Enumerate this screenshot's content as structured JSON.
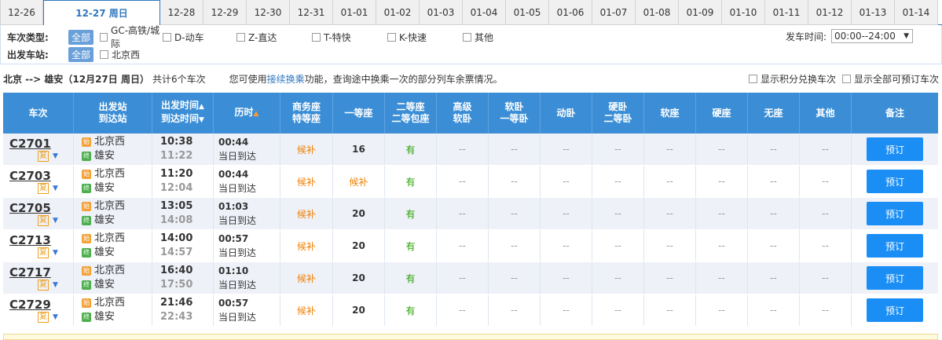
{
  "date_tabs": [
    {
      "label": "12-26",
      "active": false
    },
    {
      "label": "12-27 周日",
      "active": true
    },
    {
      "label": "12-28",
      "active": false
    },
    {
      "label": "12-29",
      "active": false
    },
    {
      "label": "12-30",
      "active": false
    },
    {
      "label": "12-31",
      "active": false
    },
    {
      "label": "01-01",
      "active": false
    },
    {
      "label": "01-02",
      "active": false
    },
    {
      "label": "01-03",
      "active": false
    },
    {
      "label": "01-04",
      "active": false
    },
    {
      "label": "01-05",
      "active": false
    },
    {
      "label": "01-06",
      "active": false
    },
    {
      "label": "01-07",
      "active": false
    },
    {
      "label": "01-08",
      "active": false
    },
    {
      "label": "01-09",
      "active": false
    },
    {
      "label": "01-10",
      "active": false
    },
    {
      "label": "01-11",
      "active": false
    },
    {
      "label": "01-12",
      "active": false
    },
    {
      "label": "01-13",
      "active": false
    },
    {
      "label": "01-14",
      "active": false
    }
  ],
  "filters": {
    "train_type_label": "车次类型:",
    "all_label": "全部",
    "train_types": [
      "GC-高铁/城际",
      "D-动车",
      "Z-直达",
      "T-特快",
      "K-快速",
      "其他"
    ],
    "station_label": "出发车站:",
    "stations": [
      "北京西"
    ],
    "depart_time_label": "发车时间:",
    "depart_time_value": "00:00--24:00"
  },
  "summary": {
    "route": "北京 --> 雄安（12月27日  周日）",
    "count": "共计6个车次",
    "tip_pre": "您可使用",
    "tip_link": "接续换乘",
    "tip_post": "功能，查询途中换乘一次的部分列车余票情况。",
    "opt1": "显示积分兑换车次",
    "opt2": "显示全部可预订车次"
  },
  "headers": {
    "train": "车次",
    "station1": "出发站",
    "station2": "到达站",
    "time1": "出发时间",
    "time2": "到达时间",
    "duration": "历时",
    "business1": "商务座",
    "business2": "特等座",
    "first": "一等座",
    "second1": "二等座",
    "second2": "二等包座",
    "soft_premium1": "高级",
    "soft_premium2": "软卧",
    "soft_sleeper1": "软卧",
    "soft_sleeper2": "一等卧",
    "moving": "动卧",
    "hard_sleeper1": "硬卧",
    "hard_sleeper2": "二等卧",
    "soft_seat": "软座",
    "hard_seat": "硬座",
    "standing": "无座",
    "other": "其他",
    "remark": "备注"
  },
  "rows": [
    {
      "train": "C2701",
      "from": "北京西",
      "to": "雄安",
      "dep": "10:38",
      "arr": "11:22",
      "dur": "00:44",
      "arrive_day": "当日到达",
      "business": "候补",
      "first": "16",
      "second": "有",
      "book": "预订"
    },
    {
      "train": "C2703",
      "from": "北京西",
      "to": "雄安",
      "dep": "11:20",
      "arr": "12:04",
      "dur": "00:44",
      "arrive_day": "当日到达",
      "business": "候补",
      "first": "候补",
      "second": "有",
      "book": "预订"
    },
    {
      "train": "C2705",
      "from": "北京西",
      "to": "雄安",
      "dep": "13:05",
      "arr": "14:08",
      "dur": "01:03",
      "arrive_day": "当日到达",
      "business": "候补",
      "first": "20",
      "second": "有",
      "book": "预订"
    },
    {
      "train": "C2713",
      "from": "北京西",
      "to": "雄安",
      "dep": "14:00",
      "arr": "14:57",
      "dur": "00:57",
      "arrive_day": "当日到达",
      "business": "候补",
      "first": "20",
      "second": "有",
      "book": "预订"
    },
    {
      "train": "C2717",
      "from": "北京西",
      "to": "雄安",
      "dep": "16:40",
      "arr": "17:50",
      "dur": "01:10",
      "arrive_day": "当日到达",
      "business": "候补",
      "first": "20",
      "second": "有",
      "book": "预订"
    },
    {
      "train": "C2729",
      "from": "北京西",
      "to": "雄安",
      "dep": "21:46",
      "arr": "22:43",
      "dur": "00:57",
      "arrive_day": "当日到达",
      "business": "候补",
      "first": "20",
      "second": "有",
      "book": "预订"
    }
  ],
  "labels": {
    "fu": "复",
    "start_badge": "始",
    "end_badge": "终",
    "dash": "--"
  },
  "colors": {
    "accent": "#3b8ed6",
    "waitlist": "#f08000",
    "available": "#26a000",
    "book_button": "#1a8ef5"
  }
}
